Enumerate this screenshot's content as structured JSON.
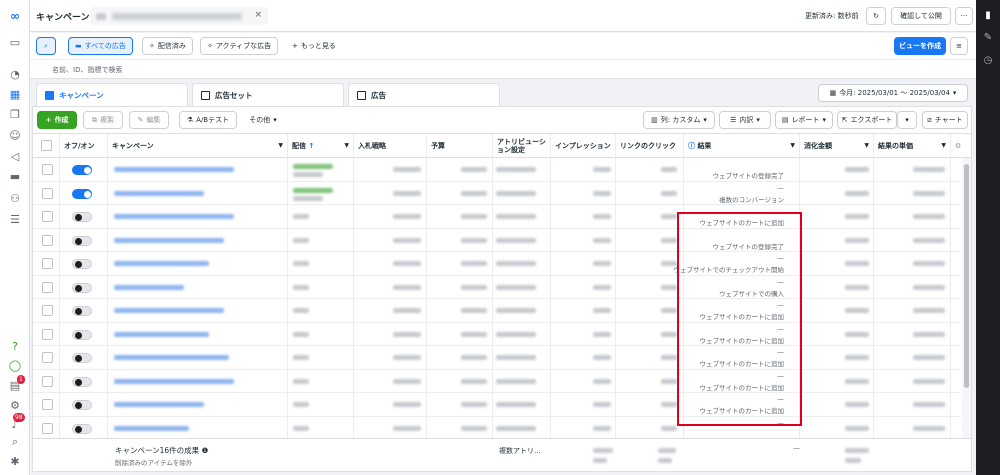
{
  "topbar": {
    "title": "キャンペーン",
    "updated": "更新済み: 数秒前",
    "review_button": "確認して公開",
    "more_button": "···"
  },
  "filters": {
    "all_ads": "すべての広告",
    "delivered": "配信済み",
    "active_ads": "アクティブな広告",
    "more": "もっと見る",
    "view_create": "ビューを作成",
    "search_placeholder": "名前、ID、指標で検索"
  },
  "tabs": {
    "campaigns": "キャンペーン",
    "adsets": "広告セット",
    "ads": "広告",
    "date_range": "今月: 2025/03/01 〜 2025/03/04"
  },
  "actions": {
    "create": "作成",
    "duplicate": "複製",
    "edit": "編集",
    "ab_test": "A/Bテスト",
    "more": "その他",
    "columns": "列: カスタム",
    "breakdown": "内訳",
    "reports": "レポート",
    "export": "エクスポート",
    "chart": "チャート"
  },
  "columns": {
    "onoff": "オフ/オン",
    "campaign": "キャンペーン",
    "delivery": "配信",
    "bid": "入札戦略",
    "budget": "予算",
    "attribution": "アトリビューション設定",
    "impressions": "インプレッション",
    "link_clicks": "リンクのクリック",
    "results": "結果",
    "spent": "消化金額",
    "cost_per_result": "結果の単価"
  },
  "rows": [
    {
      "on": true,
      "dash": "",
      "result_label": "ウェブサイトの登録完了"
    },
    {
      "on": true,
      "dash": "—",
      "result_label": "複数のコンバージョン"
    },
    {
      "on": false,
      "dash": "",
      "result_label": "ウェブサイトのカートに追加"
    },
    {
      "on": false,
      "dash": "",
      "result_label": "ウェブサイトの登録完了"
    },
    {
      "on": false,
      "dash": "—",
      "result_label": "ウェブサイトでのチェックアウト開始"
    },
    {
      "on": false,
      "dash": "—",
      "result_label": "ウェブサイトでの購入"
    },
    {
      "on": false,
      "dash": "—",
      "result_label": "ウェブサイトのカートに追加"
    },
    {
      "on": false,
      "dash": "—",
      "result_label": "ウェブサイトのカートに追加"
    },
    {
      "on": false,
      "dash": "—",
      "result_label": "ウェブサイトのカートに追加"
    },
    {
      "on": false,
      "dash": "—",
      "result_label": "ウェブサイトのカートに追加"
    },
    {
      "on": false,
      "dash": "—",
      "result_label": "ウェブサイトのカートに追加"
    },
    {
      "on": false,
      "dash": "—",
      "result_label": ""
    }
  ],
  "footer": {
    "summary": "キャンペーン16件の成果",
    "note": "削除済みのアイテムを除外",
    "attribution": "複数アトリ...",
    "results": "—"
  },
  "badges": {
    "notifications": "98",
    "alerts": "1"
  }
}
